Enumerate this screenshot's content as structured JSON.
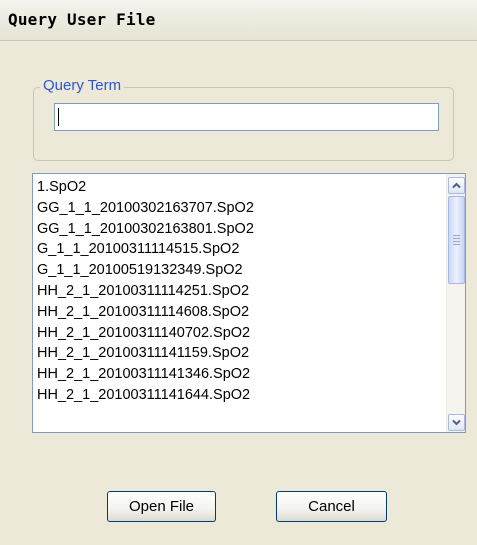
{
  "window": {
    "title": "Query User File"
  },
  "query_group": {
    "legend": "Query Term",
    "input_value": ""
  },
  "file_list": {
    "items": [
      "1.SpO2",
      "GG_1_1_20100302163707.SpO2",
      "GG_1_1_20100302163801.SpO2",
      "G_1_1_20100311114515.SpO2",
      "G_1_1_20100519132349.SpO2",
      "HH_2_1_20100311114251.SpO2",
      "HH_2_1_20100311114608.SpO2",
      "HH_2_1_20100311140702.SpO2",
      "HH_2_1_20100311141159.SpO2",
      "HH_2_1_20100311141346.SpO2",
      "HH_2_1_20100311141644.SpO2"
    ]
  },
  "buttons": {
    "open_label": "Open File",
    "cancel_label": "Cancel"
  },
  "icons": {
    "scroll_up": "chevron-up-icon",
    "scroll_down": "chevron-down-icon"
  },
  "colors": {
    "legend_text": "#2b56d6",
    "window_bg": "#ece9d8",
    "input_border": "#7f9db9"
  }
}
